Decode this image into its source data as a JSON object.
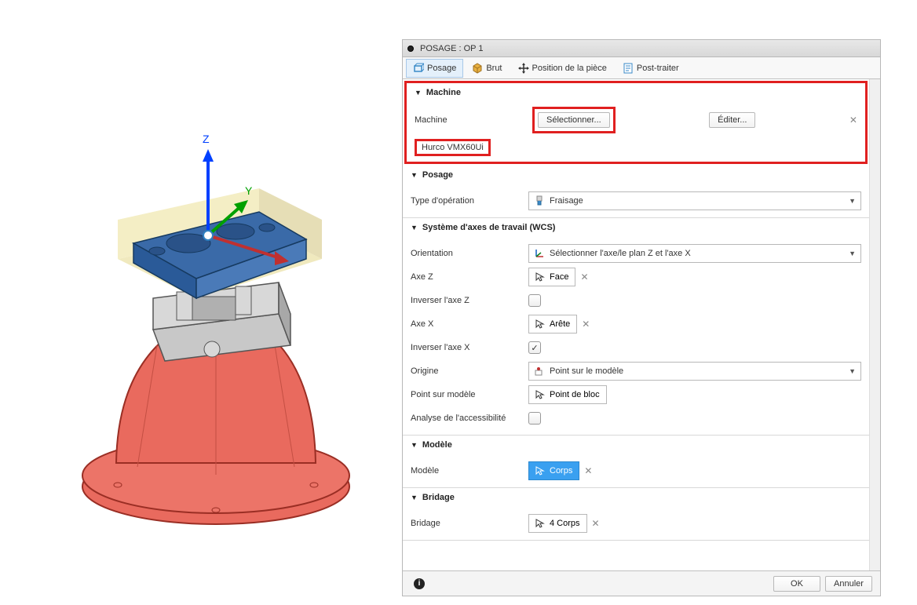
{
  "panel": {
    "title": "POSAGE : OP 1"
  },
  "tabs": {
    "posage": "Posage",
    "brut": "Brut",
    "position": "Position de la pièce",
    "post": "Post-traiter"
  },
  "sections": {
    "machine": {
      "header": "Machine",
      "label": "Machine",
      "select_btn": "Sélectionner...",
      "edit_btn": "Éditer...",
      "name": "Hurco VMX60Ui"
    },
    "posage": {
      "header": "Posage",
      "op_type_label": "Type d'opération",
      "op_type_value": "Fraisage"
    },
    "wcs": {
      "header": "Système d'axes de travail (WCS)",
      "orientation_label": "Orientation",
      "orientation_value": "Sélectionner l'axe/le plan Z et l'axe X",
      "axe_z_label": "Axe Z",
      "axe_z_value": "Face",
      "inv_z_label": "Inverser l'axe Z",
      "axe_x_label": "Axe X",
      "axe_x_value": "Arête",
      "inv_x_label": "Inverser l'axe X",
      "origine_label": "Origine",
      "origine_value": "Point sur le modèle",
      "point_label": "Point sur modèle",
      "point_value": "Point de bloc",
      "access_label": "Analyse de l'accessibilité"
    },
    "modele": {
      "header": "Modèle",
      "label": "Modèle",
      "value": "Corps"
    },
    "bridage": {
      "header": "Bridage",
      "label": "Bridage",
      "value": "4 Corps"
    }
  },
  "footer": {
    "ok": "OK",
    "cancel": "Annuler"
  },
  "viewport": {
    "axes": {
      "z": "Z",
      "y": "Y"
    }
  }
}
